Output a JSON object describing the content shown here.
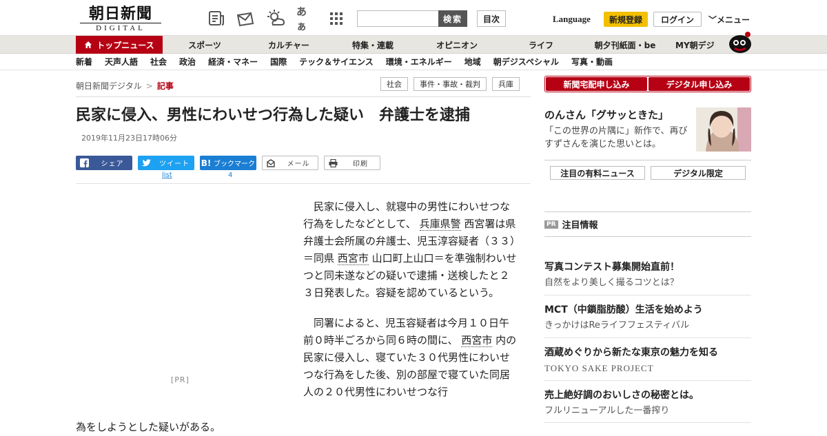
{
  "header": {
    "logo_main": "朝日新聞",
    "logo_sub": "DIGITAL",
    "icons": [
      "paper-icon",
      "envelope-icon",
      "weather-icon",
      "font-size-icon",
      "grid-icon"
    ],
    "font_icon_text": "あぁ",
    "search_placeholder": "",
    "search_button": "検索",
    "toc_button": "目次",
    "language": "Language",
    "signup": "新規登録",
    "login": "ログイン",
    "menu": "メニュー"
  },
  "gnav": {
    "items": [
      "トップニュース",
      "スポーツ",
      "カルチャー",
      "特集・連載",
      "オピニオン",
      "ライフ",
      "朝夕刊紙面・be",
      "MY朝デジ"
    ]
  },
  "snav": {
    "items": [
      "新着",
      "天声人語",
      "社会",
      "政治",
      "経済・マネー",
      "国際",
      "テック＆サイエンス",
      "環境・エネルギー",
      "地域",
      "朝デジスペシャル",
      "写真・動画"
    ]
  },
  "breadcrumb": {
    "home": "朝日新聞デジタル",
    "sep": ">",
    "current": "記事"
  },
  "tags": [
    "社会",
    "事件・事故・裁判",
    "兵庫"
  ],
  "article": {
    "headline": "民家に侵入、男性にわいせつ行為した疑い　弁護士を逮捕",
    "date": "2019年11月23日17時06分",
    "share": {
      "facebook": "シェア",
      "twitter": "ツイート",
      "hatena": "ブックマーク",
      "mail": "メール",
      "print": "印刷",
      "twitter_count": "list",
      "hatena_count": "4"
    },
    "pr_label": "[PR]",
    "p1_a": "民家に侵入し、就寝中の男性にわいせつな行為をしたなどとして、",
    "p1_kw1": "兵庫県警",
    "p1_b": "西宮署は県弁護士会所属の弁護士、児玉淳容疑者（３３）＝同県",
    "p1_kw2": "西宮市",
    "p1_c": "山口町上山口＝を準強制わいせつと同未遂などの疑いで逮捕・送検したと２３日発表した。容疑を認めているという。",
    "p2_a": "同署によると、児玉容疑者は今月１０日午前０時半ごろから同６時の間に、",
    "p2_kw": "西宮市",
    "p2_b": "内の民家に侵入し、寝ていた３０代男性にわいせつな行為をした後、別の部屋で寝ていた同居人の２０代男性にわいせつな行",
    "tail": "為をしようとした疑いがある。"
  },
  "sidebar": {
    "btn_delivery": "新聞宅配申し込み",
    "btn_digital": "デジタル申し込み",
    "promo_title": "のんさん「グサッときた」",
    "promo_desc": "「この世界の片隅に」新作で、再びすずさんを演じた思いとは。",
    "tab_paid": "注目の有料ニュース",
    "tab_digital": "デジタル限定",
    "pr_badge": "PR",
    "pr_head": "注目情報",
    "ads": [
      {
        "title": "写真コンテスト募集開始直前！",
        "sub": "自然をより美しく撮るコツとは？"
      },
      {
        "title": "MCT（中鎖脂肪酸）生活を始めよう",
        "sub": "きっかけはReライフフェスティバル"
      },
      {
        "title": "酒蔵めぐりから新たな東京の魅力を知る",
        "sub": "TOKYO SAKE PROJECT"
      },
      {
        "title": "売上絶好調のおいしさの秘密とは。",
        "sub": "フルリニューアルした一番搾り"
      }
    ]
  },
  "colors": {
    "brand_red": "#b60014",
    "signup_yellow": "#f3c000",
    "facebook": "#3b5998",
    "twitter": "#1da1f2",
    "hatena": "#1a7ed4"
  }
}
